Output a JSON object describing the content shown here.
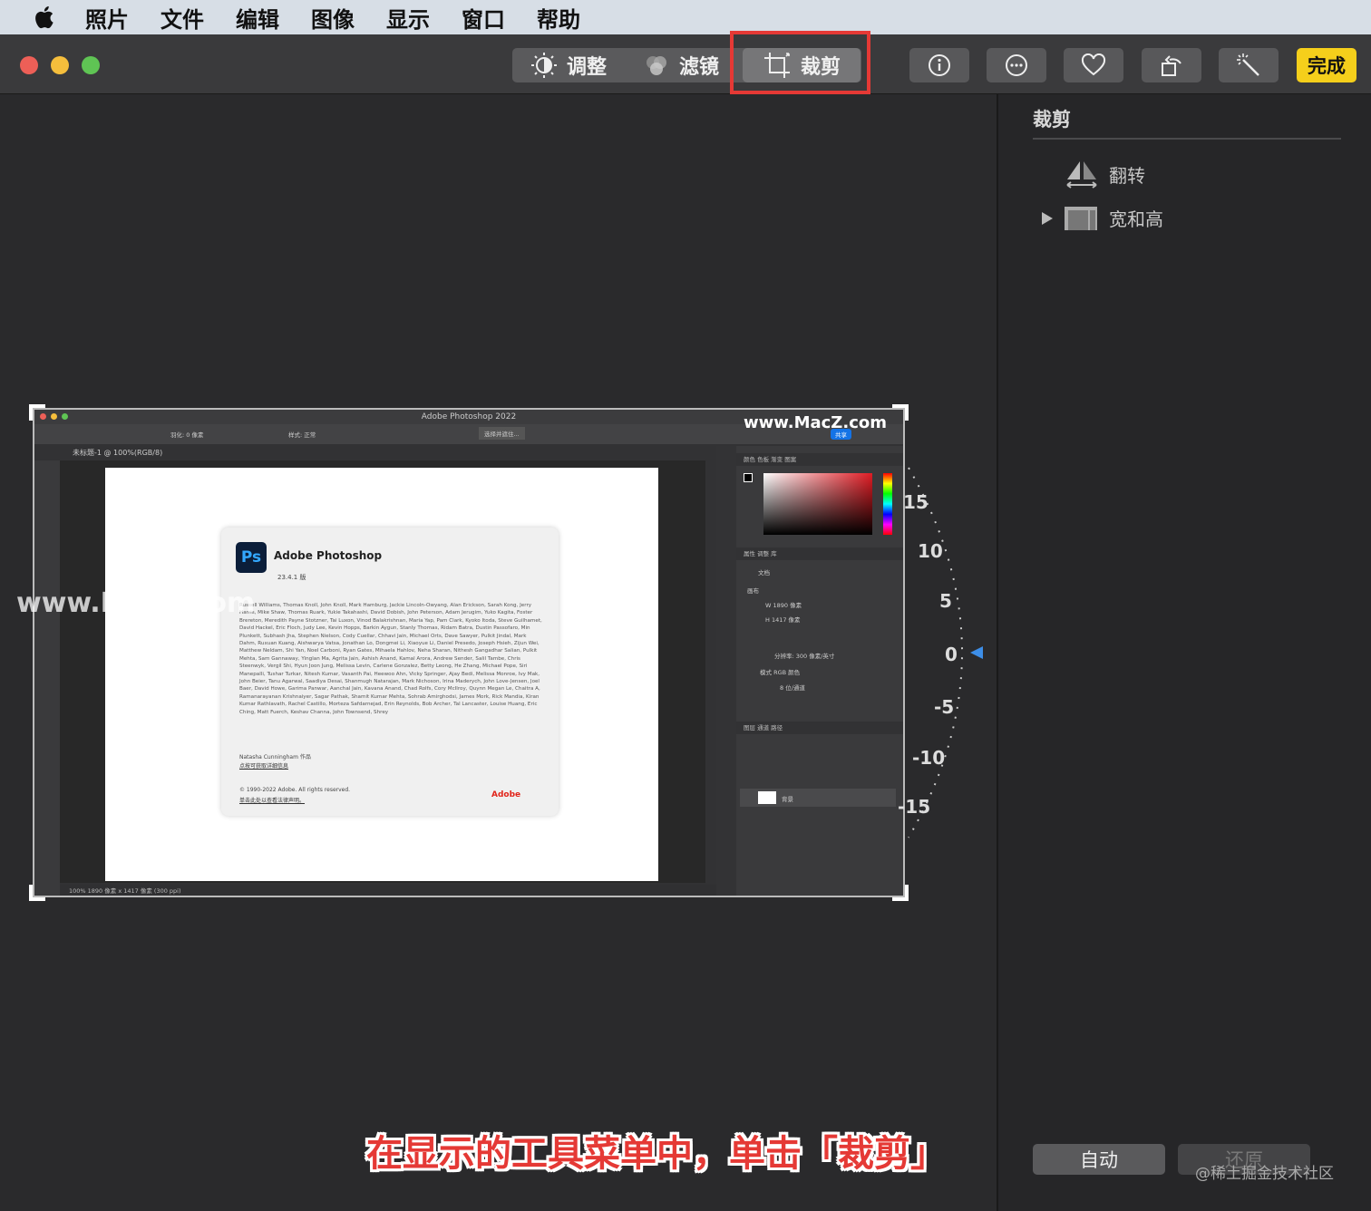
{
  "menubar": {
    "items": [
      "照片",
      "文件",
      "编辑",
      "图像",
      "显示",
      "窗口",
      "帮助"
    ]
  },
  "toolbar": {
    "tabs": [
      {
        "label": "调整",
        "icon": "adjust-icon"
      },
      {
        "label": "滤镜",
        "icon": "filters-icon"
      },
      {
        "label": "裁剪",
        "icon": "crop-icon",
        "active": true
      }
    ],
    "buttons": [
      "info-icon",
      "more-icon",
      "favorite-icon",
      "rotate-icon",
      "auto-enhance-icon"
    ],
    "done_label": "完成"
  },
  "sidebar": {
    "title": "裁剪",
    "flip_label": "翻转",
    "aspect_label": "宽和高",
    "auto_label": "自动",
    "reset_label": "还原"
  },
  "straighten_dial": {
    "labels": [
      "15",
      "10",
      "5",
      "0",
      "-5",
      "-10",
      "-15"
    ],
    "current_value": 0
  },
  "photo": {
    "ps_window_title": "Adobe Photoshop 2022",
    "ps_tab": "未标题-1 @ 100%(RGB/8)",
    "ps_feather_label": "羽化: 0 像素",
    "ps_style_label": "样式: 正常",
    "ps_select_button": "选择并遮住...",
    "ps_share": "共享",
    "about_name": "Adobe Photoshop",
    "about_version": "23.4.1 版",
    "about_credits": "Russell Williams, Thomas Knoll, John Knoll, Mark Hamburg, Jackie Lincoln-Owyang, Alan Erickson, Sarah Kong, Jerry Harris, Mike Shaw, Thomas Ruark, Yukie Takahashi, David Dobish, John Peterson, Adam Jerugim, Yuko Kagita, Foster Brereton, Meredith Payne Stotzner, Tai Luxon, Vinod Balakrishnan, Maria Yap, Pam Clark, Kyoko Itoda, Steve Guilhamet, David Hackel, Eric Floch, Judy Lee, Kevin Hopps, Barkin Aygun, Stanly Thomas, Ridam Batra, Dustin Passofaro, Min Plunkett, Subhash Jha, Stephen Nielson, Cody Cuellar, Chhavi Jain, Michael Orts, Dave Sawyer, Pulkit Jindal, Mark Dahm, Ruxuan Kuang, Aishwarya Vatsa, Jonathan Lo, Dongmei Li, Xiaoyue Li, Daniel Presedo, Joseph Hsieh, Zijun Wei, Matthew Neldam, Shi Yan, Noel Carboni, Ryan Gates, Mihaela Hahlov, Neha Sharan, Nithesh Gangadhar Salian, Pulkit Mehta, Sam Gannaway, Yinglan Ma, Agrita Jain, Ashish Anand, Kamal Arora, Andrew Sender, Salil Tambe, Chris Steenwyk, Vergil Shi, Hyun Joon Jung, Melissa Levin, Carlene Gonzalez, Betty Leong, He Zhang, Michael Pope, Siri Manepalli, Tushar Turkar, Nitesh Kumar, Vasanth Pai, Heewoo Ahn, Vicky Springer, Ajay Bedi, Melissa Monroe, Ivy Mak, John Beier, Tanu Agarwal, Saadiya Desai, Shanmugh Natarajan, Mark Nichoson, Irina Maderych, John Love-Jensen, Joel Baer, David Howe, Garima Panwar, Aanchal Jain, Kavana Anand, Chad Rolfs, Cory McIlroy, Quynn Megan Le, Chaitra A, Ramanarayanan Krishnaiyer, Sagar Pathak, Shamit Kumar Mehta, Sohrab Amirghodsi, James Mork, Rick Mandia, Kiran Kumar Rathlavath, Rachel Castillo, Morteza Safdarnejad, Erin Reynolds, Bob Archer, Tal Lancaster, Louise Huang, Eric Ching, Matt Fuerch, Keshav Channa, John Townsend, Shrey",
    "about_author": "Natasha Cunningham 作品",
    "about_link": "点按可获取详细信息",
    "about_copyright": "© 1990-2022 Adobe. All rights reserved.",
    "about_rights": "单击此处以查看法律声明。",
    "adobe_label": "Adobe",
    "ps_status": "100%    1890 像素 x 1417 像素 (300 ppi)",
    "panel_color_tabs": "颜色    色板    渐变    图案",
    "panel_props_tabs": "属性    调整    库",
    "panel_doc": "文档",
    "panel_canvas": "画布",
    "panel_w": "W  1890 像素",
    "panel_h": "H  1417 像素",
    "panel_res": "分辨率: 300 像素/英寸",
    "panel_mode": "模式    RGB 颜色",
    "panel_bits": "8 位/通道",
    "panel_layers_tabs": "图层    通道    路径",
    "panel_layer_name": "背景"
  },
  "watermarks": {
    "macz_top": "www.MacZ.com",
    "macz_left": "www.MacZ.com",
    "juejin": "@稀土掘金技术社区"
  },
  "caption": "在显示的工具菜单中，单击「裁剪」"
}
